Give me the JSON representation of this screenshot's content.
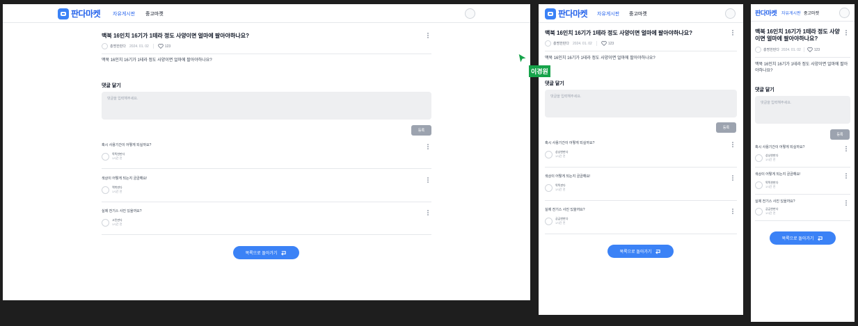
{
  "brand": {
    "name": "판다마켓",
    "color": "#3b82f6"
  },
  "nav": {
    "board": "자유게시판",
    "market": "중고마켓"
  },
  "post": {
    "title": "맥북 16인치 16기가 1테라 정도 사양이면 얼마에 팔아야하나요?",
    "author": "총명한판다",
    "date": "2024. 01. 02",
    "likes": "123",
    "body": "맥북 16인치 16기가 1테라 정도 사양이면 얼마에 팔아야하나요?"
  },
  "comment_form": {
    "heading": "댓글 달기",
    "placeholder": "댓글을 입력해주세요.",
    "submit": "등록"
  },
  "comments_f1": [
    {
      "text": "혹시 사용기간이 어떻게 되실까요?",
      "author": "똑똑한판다",
      "time": "1시간 전"
    },
    {
      "text": "색상이 어떻게 되는지 궁금해요!",
      "author": "맥북판다",
      "time": "1시간 전"
    },
    {
      "text": "실제 전기스 사진 있을까요?",
      "author": "고민판다",
      "time": "1시간 전"
    }
  ],
  "comments_f2": [
    {
      "text": "혹시 사용기간이 어떻게 되실까요?",
      "author": "상냥한판다",
      "time": "1시간 전"
    },
    {
      "text": "색상이 어떻게 되는지 궁금해요!",
      "author": "똑똑판다",
      "time": "1시간 전"
    },
    {
      "text": "실제 전기스 사진 있을까요?",
      "author": "궁금한판다",
      "time": "1시간 전"
    }
  ],
  "comments_f3": [
    {
      "text": "혹시 사용기간이 어떻게 되실까요?",
      "author": "상냥한판다",
      "time": "1시간 전"
    },
    {
      "text": "색상이 어떻게 되는지 궁금해요!",
      "author": "똑똑한판다",
      "time": "1시간 전"
    },
    {
      "text": "실제 전기스 사진 있을까요?",
      "author": "궁금한판다",
      "time": "1시간 전"
    }
  ],
  "back_button": "목록으로 돌아가기",
  "collaborator": {
    "name": "이경원",
    "color": "#16a34a"
  }
}
